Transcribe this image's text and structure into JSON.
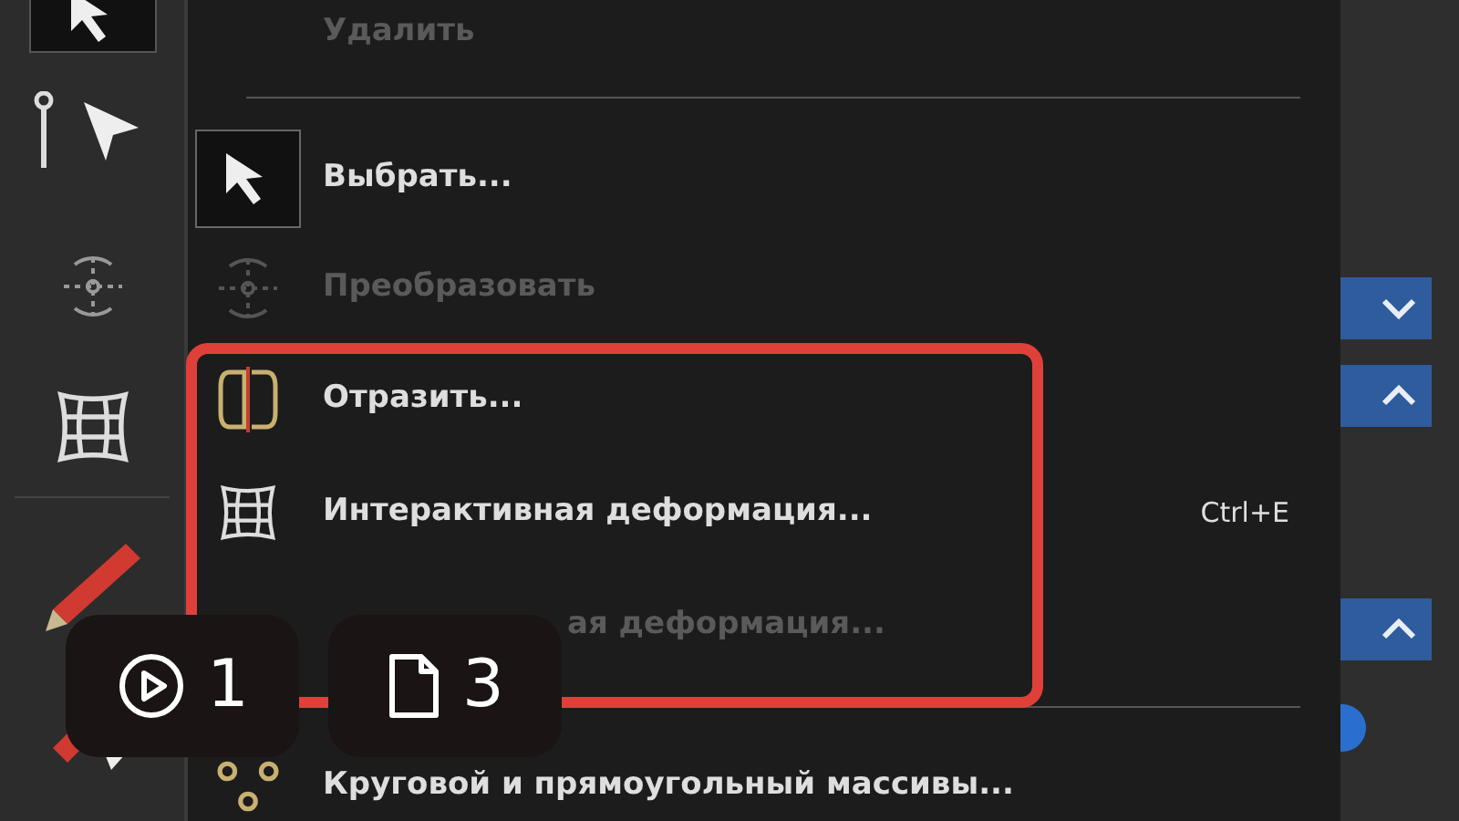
{
  "toolbar": {
    "tools": [
      {
        "selected": true
      },
      {
        "selected": false
      },
      {
        "selected": false
      },
      {
        "selected": false
      },
      {
        "selected": false
      },
      {
        "selected": false
      }
    ]
  },
  "menu": {
    "items": [
      {
        "kind": "item",
        "label": "Удалить",
        "disabled": true,
        "checked": false
      },
      {
        "kind": "separator"
      },
      {
        "kind": "item",
        "label": "Выбрать...",
        "disabled": false,
        "checked": true
      },
      {
        "kind": "item",
        "label": "Преобразовать",
        "disabled": true,
        "checked": false
      },
      {
        "kind": "item",
        "label": "Отразить...",
        "disabled": false,
        "checked": false
      },
      {
        "kind": "item",
        "label": "Интерактивная деформация...",
        "shortcut": "Ctrl+E",
        "disabled": false,
        "checked": false
      },
      {
        "kind": "covered",
        "label": "ая деформация...",
        "disabled": true,
        "checked": false
      },
      {
        "kind": "separator"
      },
      {
        "kind": "item",
        "label": "Круговой и прямоугольный массивы...",
        "disabled": false,
        "checked": false
      }
    ]
  },
  "side_buttons": [
    {
      "kind": "down"
    },
    {
      "kind": "up"
    },
    {
      "kind": "up"
    }
  ],
  "overlay": {
    "plays": "1",
    "pages": "3"
  }
}
